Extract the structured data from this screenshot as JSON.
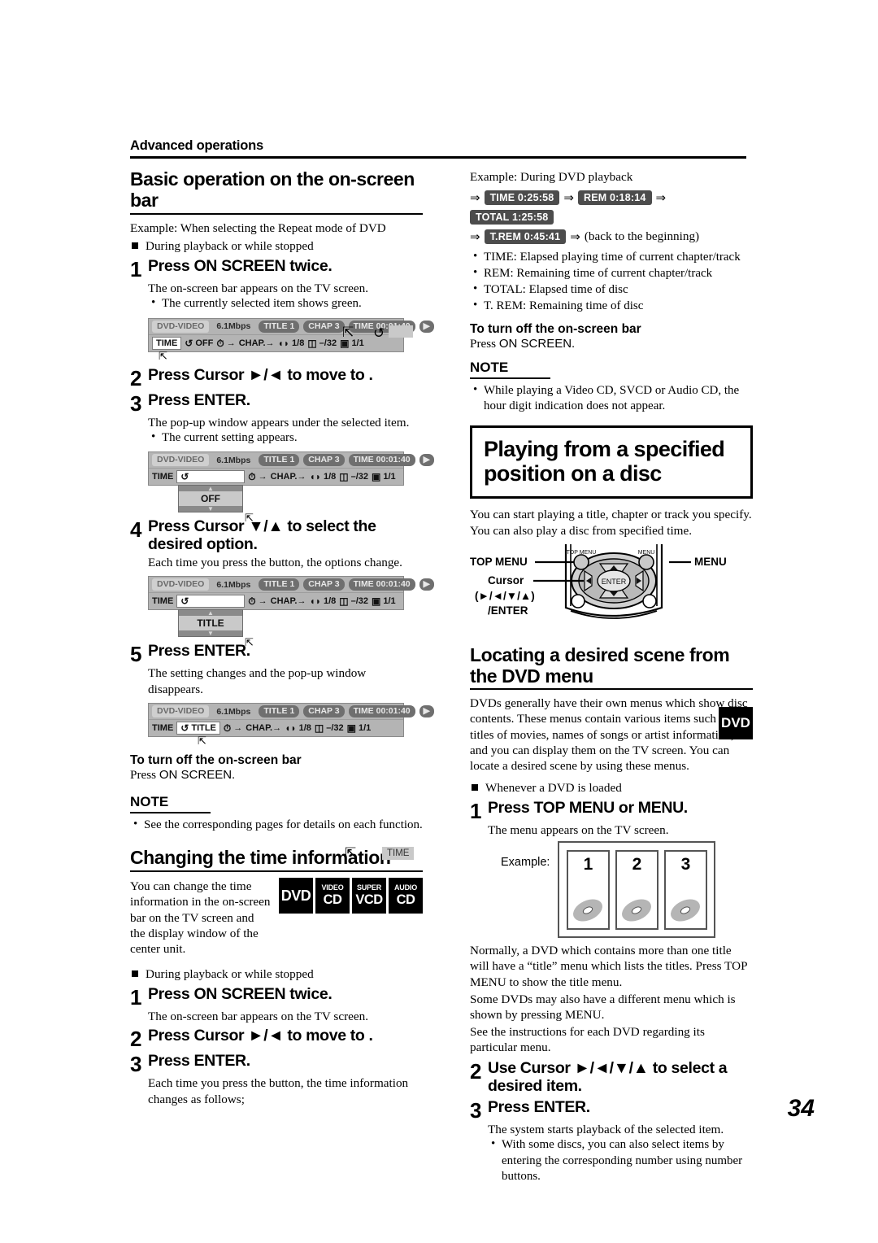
{
  "running_head": "Advanced operations",
  "page_number": "34",
  "left": {
    "section1_title": "Basic operation on the on-screen bar",
    "example_line": "Example: When selecting the Repeat mode of DVD",
    "bullet_during": "During playback or while stopped",
    "step1": {
      "num": "1",
      "text": "Press ON SCREEN twice.",
      "sub": "The on-screen bar appears on the TV screen.",
      "dot": "The currently selected item shows green."
    },
    "step2": {
      "num": "2",
      "text": "Press Cursor ►/◄ to move  to  ."
    },
    "step3": {
      "num": "3",
      "text": "Press ENTER.",
      "sub": "The pop-up window appears under the selected item.",
      "dot": "The current setting appears."
    },
    "step4": {
      "num": "4",
      "text": "Press Cursor ▼/▲ to select the desired option.",
      "sub": "Each time you press the button, the options change."
    },
    "step5": {
      "num": "5",
      "text": "Press ENTER.",
      "sub": "The setting changes and the pop-up window disappears."
    },
    "turnoff_head": "To turn off the on-screen bar",
    "turnoff_press": "Press ",
    "turnoff_btn": "ON SCREEN.",
    "note_head": "NOTE",
    "note_dot": "See the corresponding pages for details on each function.",
    "section2_title": "Changing the time information",
    "section2_body": "You can change the time information in the on-screen bar on the TV screen and the display window of the center unit.",
    "badges": [
      {
        "top": "",
        "main": "DVD"
      },
      {
        "top": "VIDEO",
        "main": "CD"
      },
      {
        "top": "SUPER",
        "main": "VCD"
      },
      {
        "top": "AUDIO",
        "main": "CD"
      }
    ],
    "s2_bullet_during": "During playback or while stopped",
    "s2_step1": {
      "num": "1",
      "text": "Press ON SCREEN twice.",
      "sub": "The on-screen bar appears on the TV screen."
    },
    "s2_step2": {
      "num": "2",
      "text": "Press Cursor ►/◄ to move  to  ."
    },
    "s2_step3": {
      "num": "3",
      "text": "Press ENTER.",
      "sub": "Each time you press the button, the time information changes as follows;"
    },
    "osb_chips": {
      "format": "DVD-VIDEO",
      "bitrate": "6.1Mbps",
      "title": "TITLE  1",
      "chap": "CHAP  3",
      "time": "TIME 00:01:40",
      "play": "▶"
    },
    "osb_row2": {
      "time_label": "TIME",
      "repeat_off": "OFF",
      "repeat_title": "TITLE",
      "clock": "→",
      "chap": "CHAP.→",
      "audio": "1/8",
      "subtitle": "–/32",
      "angle": "1/1"
    },
    "popup_off": "OFF",
    "popup_title": "TITLE"
  },
  "right": {
    "example_dvd": "Example: During DVD playback",
    "time_seq_1": [
      "TIME  0:25:58",
      "REM  0:18:14",
      "TOTAL  1:25:58"
    ],
    "time_seq_2": [
      "T.REM  0:45:41"
    ],
    "back_to_beginning": "(back to the beginning)",
    "defs": [
      "TIME:    Elapsed playing time of current chapter/track",
      "REM:     Remaining time of current chapter/track",
      "TOTAL: Elapsed time of disc",
      "T. REM: Remaining time of disc"
    ],
    "turnoff_head": "To turn off the on-screen bar",
    "turnoff_press": "Press ",
    "turnoff_btn": "ON SCREEN.",
    "note_head": "NOTE",
    "note_dot": "While playing a Video CD, SVCD or Audio CD, the hour digit indication does not appear.",
    "boxtitle": "Playing from a specified position on a disc",
    "box_body": "You can start playing a title, chapter or track you specify. You can also play a disc from specified time.",
    "remote": {
      "top_menu_label": "TOP MENU",
      "menu_label": "MENU",
      "cursor_label": "Cursor",
      "cursor_keys": "(►/◄/▼/▲)",
      "enter_label": "/ENTER",
      "btn_top_menu": "TOP MENU",
      "btn_menu": "MENU",
      "btn_enter": "ENTER"
    },
    "section_title": "Locating a desired scene from the DVD menu",
    "section_body": "DVDs generally have their own menus which show disc contents. These menus contain various items such as titles of movies, names of songs or artist information, and you can display them on the TV screen. You can locate a desired scene by using these menus.",
    "badge_dvd": "DVD",
    "bullet_loaded": "Whenever a DVD is loaded",
    "step1": {
      "num": "1",
      "text": "Press TOP MENU or MENU.",
      "sub": "The menu appears on the TV screen."
    },
    "example_label": "Example:",
    "thumbs": [
      "1",
      "2",
      "3"
    ],
    "para_normally": "Normally, a DVD which contains more than one title will have a “title” menu which lists the titles. Press TOP MENU to show the title menu.",
    "para_some": "Some DVDs may also have a different menu which is shown by pressing MENU.",
    "para_see": "See the instructions for each DVD regarding its particular menu.",
    "step2": {
      "num": "2",
      "text": "Use Cursor ►/◄/▼/▲ to select a desired item."
    },
    "step3": {
      "num": "3",
      "text": "Press ENTER.",
      "sub": "The system starts playback of the selected item.",
      "dot": "With some discs, you can also select items by entering the corresponding number using number buttons."
    }
  }
}
